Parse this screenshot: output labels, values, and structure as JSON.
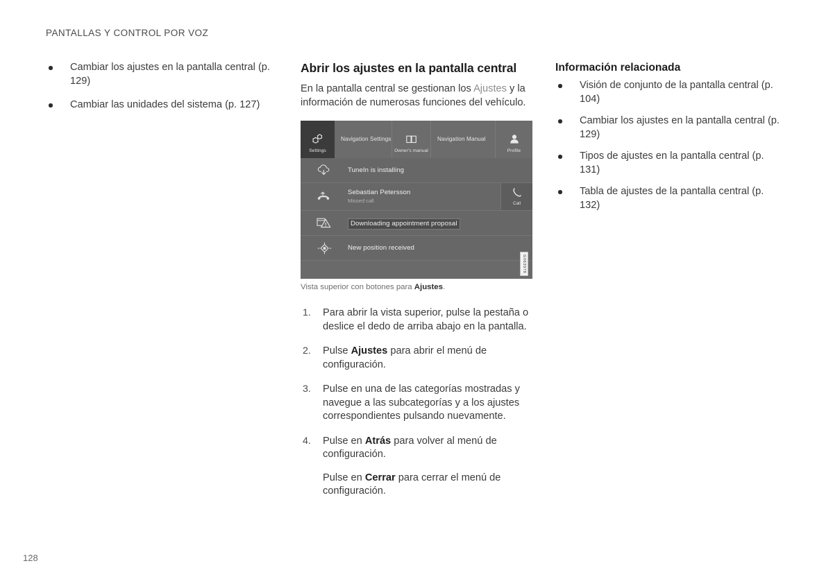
{
  "header": {
    "running_title": "PANTALLAS Y CONTROL POR VOZ"
  },
  "folio": {
    "page_number": "128"
  },
  "left_column": {
    "bullets": [
      "Cambiar los ajustes en la pantalla central (p. 129)",
      "Cambiar las unidades del sistema (p. 127)"
    ]
  },
  "middle_column": {
    "section_title": "Abrir los ajustes en la pantalla central",
    "intro_part1": "En la pantalla central se gestionan los ",
    "intro_accent": "Ajustes",
    "intro_part2": " y la información de numerosas funciones del vehículo.",
    "figure": {
      "caption_prefix": "Vista superior con botones para ",
      "caption_bold": "Ajustes",
      "caption_suffix": ".",
      "figure_id": "G063978",
      "tabs": [
        {
          "label": "Settings",
          "icon": "gears-icon"
        },
        {
          "label": "Navigation Settings",
          "icon": "none"
        },
        {
          "label": "Owner's manual",
          "icon": "book-icon"
        },
        {
          "label": "Navigation Manual",
          "icon": "none"
        },
        {
          "label": "Profile",
          "icon": "person-icon"
        }
      ],
      "notifications": [
        {
          "title": "TuneIn is installing",
          "subtitle": "",
          "icon": "cloud-download-icon",
          "action": "",
          "highlighted": false
        },
        {
          "title": "Sebastian Petersson",
          "subtitle": "Missed call",
          "icon": "missed-call-icon",
          "action": "Call",
          "action_icon": "phone-icon",
          "highlighted": false
        },
        {
          "title": "Downloading appointment proposal",
          "subtitle": "",
          "icon": "calendar-warning-icon",
          "action": "",
          "highlighted": true
        },
        {
          "title": "New position received",
          "subtitle": "",
          "icon": "compass-icon",
          "action": "",
          "highlighted": false
        }
      ]
    },
    "steps": [
      {
        "number": "1.",
        "parts": [
          {
            "text": "Para abrir la vista superior, pulse la pestaña o deslice el dedo de arriba abajo en la pantalla.",
            "bold": false
          }
        ]
      },
      {
        "number": "2.",
        "parts": [
          {
            "text": "Pulse ",
            "bold": false
          },
          {
            "text": "Ajustes",
            "bold": true
          },
          {
            "text": " para abrir el menú de configuración.",
            "bold": false
          }
        ]
      },
      {
        "number": "3.",
        "parts": [
          {
            "text": "Pulse en una de las categorías mostradas y navegue a las subcategorías y a los ajustes correspondientes pulsando nuevamente.",
            "bold": false
          }
        ]
      },
      {
        "number": "4.",
        "parts": [
          {
            "text": "Pulse en ",
            "bold": false
          },
          {
            "text": "Atrás",
            "bold": true
          },
          {
            "text": " para volver al menú de configuración.",
            "bold": false
          }
        ],
        "extra_parts": [
          {
            "text": "Pulse en ",
            "bold": false
          },
          {
            "text": "Cerrar",
            "bold": true
          },
          {
            "text": " para cerrar el menú de configuración.",
            "bold": false
          }
        ]
      }
    ]
  },
  "right_column": {
    "title": "Información relacionada",
    "bullets": [
      "Visión de conjunto de la pantalla central (p. 104)",
      "Cambiar los ajustes en la pantalla central (p. 129)",
      "Tipos de ajustes en la pantalla central (p. 131)",
      "Tabla de ajustes de la pantalla central (p. 132)"
    ]
  },
  "colors": {
    "page_background": "#ffffff",
    "body_text": "#3b3b3b",
    "heading_text": "#1d1d1d",
    "accent_gray": "#8d8d8d",
    "caption_gray": "#6e6e6e",
    "display_background": "#6a6a6a",
    "display_tab_active": "#3c3b3c"
  }
}
